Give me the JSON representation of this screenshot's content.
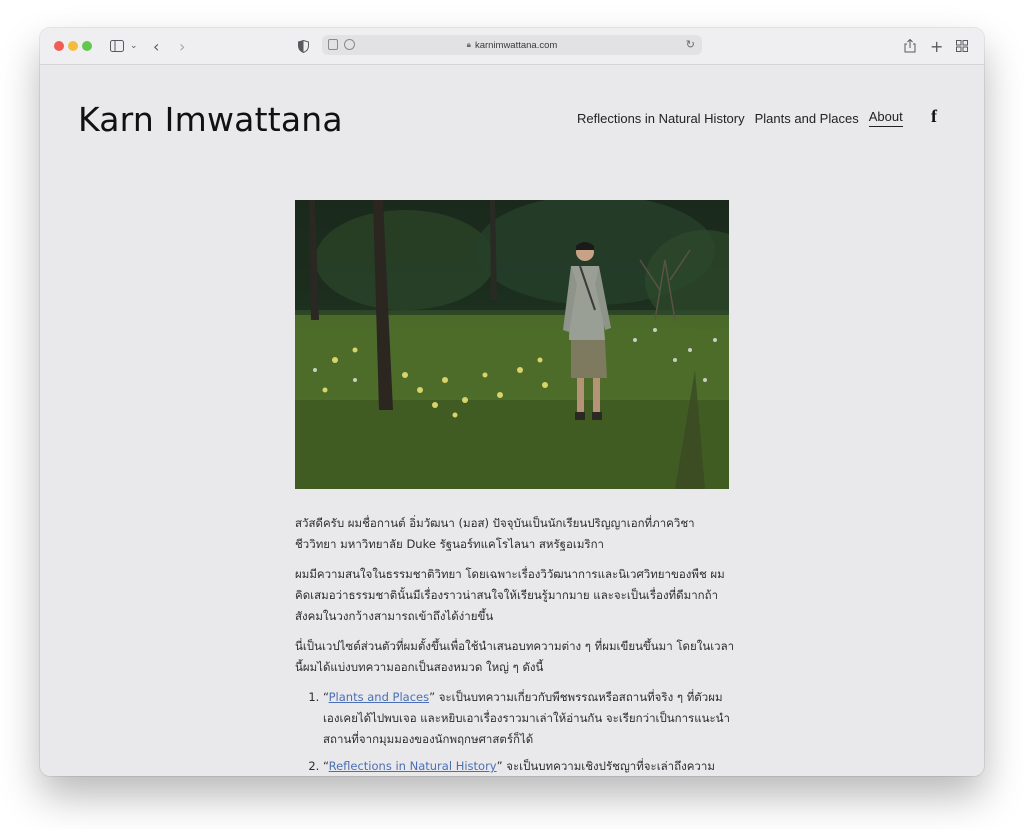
{
  "browser": {
    "url": "karnimwattana.com",
    "colors": {
      "close": "#ee5e57",
      "minimize": "#f2bd3e",
      "zoom": "#5fc84d"
    }
  },
  "site": {
    "title": "Karn Imwattana",
    "nav": [
      {
        "label": "Reflections in Natural History"
      },
      {
        "label": "Plants and Places"
      },
      {
        "label": "About",
        "active": true
      }
    ],
    "social_icon": "facebook-icon"
  },
  "content": {
    "p1": "สวัสดีครับ ผมชื่อกานต์ อิ่มวัฒนา (มอส) ปัจจุบันเป็นนักเรียนปริญญาเอกที่ภาควิชาชีววิทยา มหาวิทยาลัย Duke รัฐนอร์ทแคโรไลนา สหรัฐอเมริกา",
    "p2": "ผมมีความสนใจในธรรมชาติวิทยา โดยเฉพาะเรื่องวิวัฒนาการและนิเวศวิทยาของพืช ผมคิดเสมอว่าธรรมชาตินั้นมีเรื่องราวน่าสนใจให้เรียนรู้มากมาย และจะเป็นเรื่องที่ดีมากถ้าสังคมในวงกว้างสามารถเข้าถึงได้ง่ายขึ้น",
    "p3": "นี่เป็นเวปไซต์ส่วนตัวที่ผมตั้งขึ้นเพื่อใช้นำเสนอบทความต่าง ๆ ที่ผมเขียนขึ้นมา โดยในเวลานี้ผมได้แบ่งบทความออกเป็นสองหมวด ใหญ่ ๆ ดังนี้",
    "list": [
      {
        "open_quote": "“",
        "link": "Plants and Places",
        "close_quote": "”",
        "rest": " จะเป็นบทความเกี่ยวกับพืชพรรณหรือสถานที่จริง ๆ ที่ตัวผมเองเคยได้ไปพบเจอ และหยิบเอาเรื่องราวมาเล่าให้อ่านกัน จะเรียกว่าเป็นการแนะนำสถานที่จากมุมมองของนักพฤกษศาสตร์ก็ได้"
      },
      {
        "open_quote": "“",
        "link": "Reflections in Natural History",
        "close_quote": "”",
        "rest": " จะเป็นบทความเชิงปรัชญาที่จะเล่าถึงความ"
      }
    ]
  }
}
